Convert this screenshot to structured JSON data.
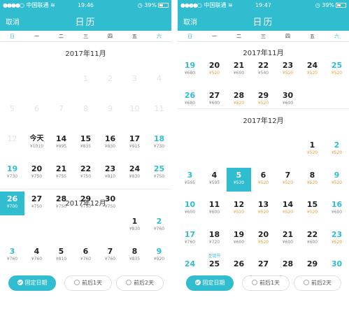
{
  "theme": {
    "accent": "#31bdd0",
    "price_highlight": "#f0a03a"
  },
  "phones": [
    {
      "status": {
        "carrier": "中国联通",
        "time": "19:46",
        "battery": "39%"
      },
      "nav": {
        "cancel": "取消",
        "title": "日历"
      },
      "weekdays": [
        "日",
        "一",
        "二",
        "三",
        "四",
        "五",
        "六"
      ],
      "months": [
        {
          "title": "2017年11月",
          "weeks": [
            [
              null,
              null,
              null,
              {
                "day": "1",
                "past": true
              },
              {
                "day": "2",
                "past": true
              },
              {
                "day": "3",
                "past": true
              },
              {
                "day": "4",
                "past": true
              }
            ],
            [
              {
                "day": "5",
                "past": true
              },
              {
                "day": "6",
                "past": true
              },
              {
                "day": "7",
                "past": true
              },
              {
                "day": "8",
                "past": true
              },
              {
                "day": "9",
                "past": true
              },
              {
                "day": "10",
                "past": true
              },
              {
                "day": "11",
                "past": true
              }
            ],
            [
              {
                "day": "12",
                "past": true
              },
              {
                "day": "今天",
                "price": "¥1010",
                "today": true
              },
              {
                "day": "14",
                "price": "¥995"
              },
              {
                "day": "15",
                "price": "¥835"
              },
              {
                "day": "16",
                "price": "¥830"
              },
              {
                "day": "17",
                "price": "¥915"
              },
              {
                "day": "18",
                "price": "¥730"
              }
            ],
            [
              {
                "day": "19",
                "price": "¥730"
              },
              {
                "day": "20",
                "price": "¥750"
              },
              {
                "day": "21",
                "price": "¥755"
              },
              {
                "day": "22",
                "price": "¥750"
              },
              {
                "day": "23",
                "price": "¥810"
              },
              {
                "day": "24",
                "price": "¥830"
              },
              {
                "day": "25",
                "price": "¥750"
              }
            ],
            [
              {
                "day": "26",
                "price": "¥700",
                "selected": true
              },
              {
                "day": "27",
                "price": "¥750"
              },
              {
                "day": "28",
                "price": "¥750"
              },
              {
                "day": "29",
                "price": "¥750"
              },
              {
                "day": "30",
                "price": "¥750"
              },
              null,
              null
            ]
          ]
        },
        {
          "title": "2017年12月",
          "weeks": [
            [
              null,
              null,
              null,
              null,
              null,
              {
                "day": "1",
                "price": "¥830"
              },
              {
                "day": "2",
                "price": "¥760"
              }
            ],
            [
              {
                "day": "3",
                "price": "¥760"
              },
              {
                "day": "4",
                "price": "¥760"
              },
              {
                "day": "5",
                "price": "¥810"
              },
              {
                "day": "6",
                "price": "¥760"
              },
              {
                "day": "7",
                "price": "¥760"
              },
              {
                "day": "8",
                "price": "¥835"
              },
              {
                "day": "9",
                "price": "¥920"
              }
            ]
          ]
        }
      ],
      "options": [
        {
          "label": "固定日期",
          "active": true
        },
        {
          "label": "前后1天",
          "active": false
        },
        {
          "label": "前后2天",
          "active": false
        }
      ]
    },
    {
      "status": {
        "carrier": "中国联通",
        "time": "19:47",
        "battery": "39%"
      },
      "nav": {
        "cancel": "取消",
        "title": "日历"
      },
      "weekdays": [
        "日",
        "一",
        "二",
        "三",
        "四",
        "五",
        "六"
      ],
      "months": [
        {
          "title": "2017年11月",
          "weeks": [
            [
              {
                "day": "19",
                "price": "¥680"
              },
              {
                "day": "20",
                "price": "¥520",
                "orange": true
              },
              {
                "day": "21",
                "price": "¥600"
              },
              {
                "day": "22",
                "price": "¥540"
              },
              {
                "day": "23",
                "price": "¥520",
                "orange": true
              },
              {
                "day": "24",
                "price": "¥520",
                "orange": true
              },
              {
                "day": "25",
                "price": "¥520",
                "orange": true
              }
            ],
            [
              {
                "day": "26",
                "price": "¥680"
              },
              {
                "day": "27",
                "price": "¥600"
              },
              {
                "day": "28",
                "price": "¥520",
                "orange": true
              },
              {
                "day": "29",
                "price": "¥520",
                "orange": true
              },
              {
                "day": "30",
                "price": "¥600"
              },
              null,
              null
            ]
          ]
        },
        {
          "title": "2017年12月",
          "weeks": [
            [
              null,
              null,
              null,
              null,
              null,
              {
                "day": "1",
                "price": "¥520",
                "orange": true
              },
              {
                "day": "2",
                "price": "¥520",
                "orange": true
              }
            ],
            [
              {
                "day": "3",
                "price": "¥595"
              },
              {
                "day": "4",
                "price": "¥595"
              },
              {
                "day": "5",
                "price": "¥520",
                "selected": true
              },
              {
                "day": "6",
                "price": "¥520",
                "orange": true
              },
              {
                "day": "7",
                "price": "¥520",
                "orange": true
              },
              {
                "day": "8",
                "price": "¥520",
                "orange": true
              },
              {
                "day": "9",
                "price": "¥520",
                "orange": true
              }
            ],
            [
              {
                "day": "10",
                "price": "¥600"
              },
              {
                "day": "11",
                "price": "¥600"
              },
              {
                "day": "12",
                "price": "¥520",
                "orange": true
              },
              {
                "day": "13",
                "price": "¥520",
                "orange": true
              },
              {
                "day": "14",
                "price": "¥520",
                "orange": true
              },
              {
                "day": "15",
                "price": "¥520",
                "orange": true
              },
              {
                "day": "16",
                "price": "¥600"
              }
            ],
            [
              {
                "day": "17",
                "price": "¥760"
              },
              {
                "day": "18",
                "price": "¥720"
              },
              {
                "day": "19",
                "price": "¥600"
              },
              {
                "day": "20",
                "price": "¥520",
                "orange": true
              },
              {
                "day": "21",
                "price": "¥600"
              },
              {
                "day": "22",
                "price": "¥600"
              },
              {
                "day": "23",
                "price": "¥520",
                "orange": true
              }
            ],
            [
              {
                "day": "24",
                "price": "¥520",
                "orange": true
              },
              {
                "day": "25",
                "price": "¥520",
                "orange": true,
                "holiday": "圣诞节"
              },
              {
                "day": "26",
                "price": "¥520",
                "orange": true
              },
              {
                "day": "27",
                "price": "¥520",
                "orange": true
              },
              {
                "day": "28",
                "price": "¥520",
                "orange": true
              },
              {
                "day": "29",
                "price": "¥520",
                "orange": true
              },
              {
                "day": "30",
                "price": "¥520",
                "orange": true
              }
            ]
          ]
        }
      ],
      "options": [
        {
          "label": "固定日期",
          "active": true
        },
        {
          "label": "前后1天",
          "active": false
        },
        {
          "label": "前后2天",
          "active": false
        }
      ]
    }
  ]
}
